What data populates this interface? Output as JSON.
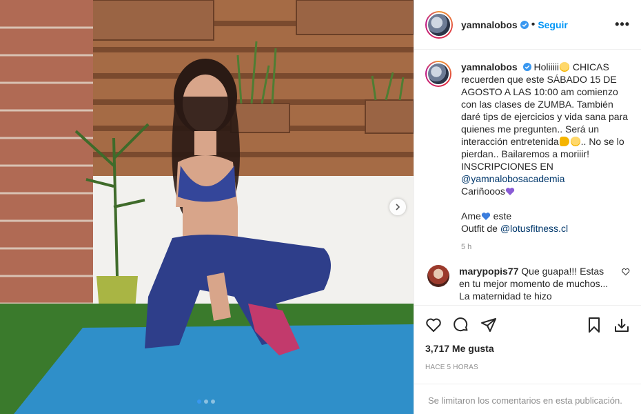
{
  "post": {
    "username": "yamnalobos",
    "separator": "•",
    "follow_label": "Seguir",
    "more_label": "•••"
  },
  "caption": {
    "username": "yamnalobos",
    "line1": " Holiiiii",
    "line1b": " CHICAS recuerden que este SÁBADO 15 DE AGOSTO A LAS 10:00 am comienzo con las clases de ZUMBA. También daré tips de ejercicios y vida sana para quienes me pregunten.. Será un interacción entretenida",
    "line2": ".. No se lo pierdan.. Bailaremos a moriiir!",
    "line3": "INSCRIPCIONES EN",
    "mention1": "@yamnalobosacademia",
    "line4": "Cariñooos",
    "line5a": "Ame",
    "line5b": " este",
    "line6": "Outfit de ",
    "mention2": "@lotusfitness.cl",
    "time": "5 h"
  },
  "comment": {
    "username": "marypopis77",
    "text": " Que guapa!!! Estas en tu mejor momento de muchos... La maternidad te hizo"
  },
  "stats": {
    "likes": "3,717 Me gusta",
    "ago": "HACE 5 HORAS"
  },
  "comments_disabled": "Se limitaron los comentarios en esta publicación.",
  "carousel": {
    "current": 1,
    "total": 3
  },
  "colors": {
    "link": "#0095f6",
    "mention": "#00376b",
    "muted": "#8e8e8e",
    "heart_blue": "#3b7ddd",
    "heart_purple": "#8a5cd6"
  },
  "icons": [
    "more-icon",
    "verified-icon",
    "heart-icon",
    "comment-icon",
    "share-icon",
    "save-icon",
    "download-icon",
    "chevron-right-icon"
  ]
}
